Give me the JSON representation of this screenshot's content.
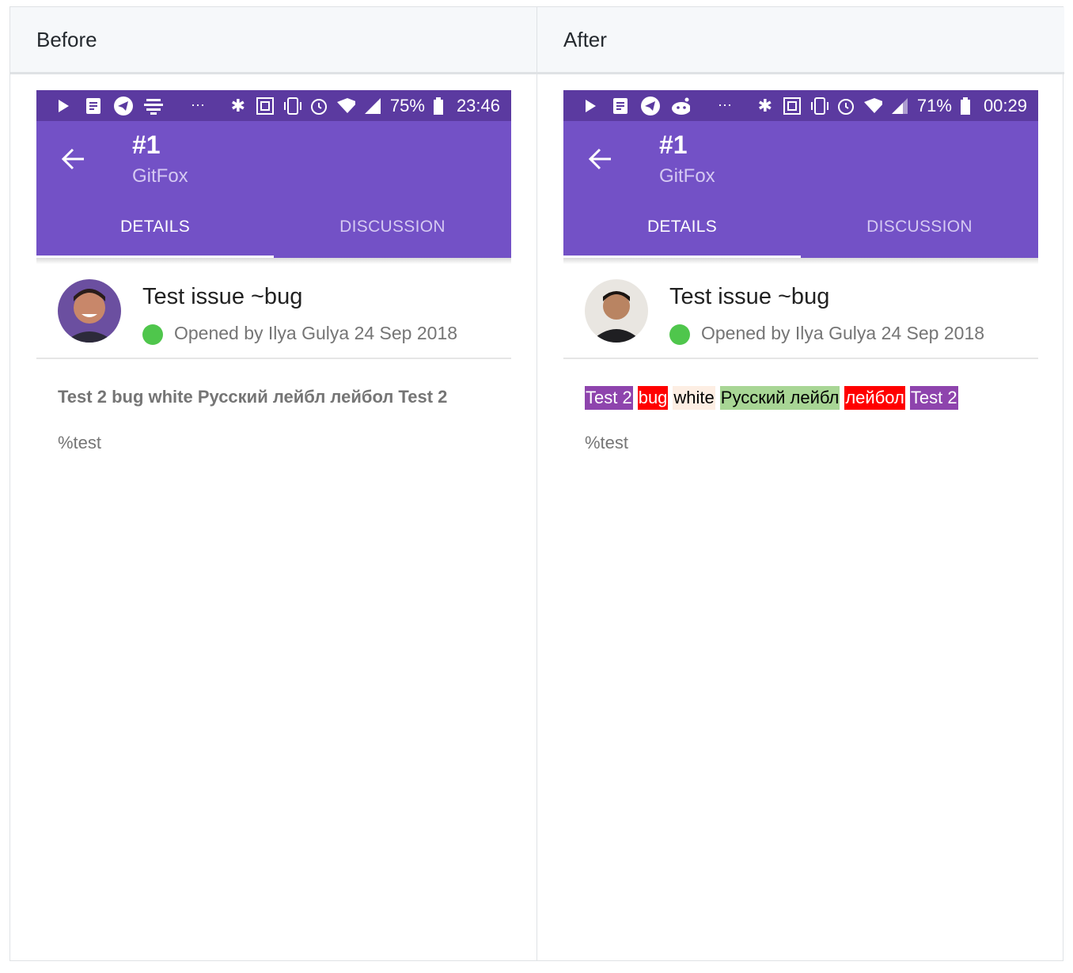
{
  "columns": {
    "before": {
      "header": "Before"
    },
    "after": {
      "header": "After"
    }
  },
  "before": {
    "status": {
      "battery": "75%",
      "time": "23:46"
    },
    "toolbar": {
      "title": "#1",
      "subtitle": "GitFox"
    },
    "tabs": [
      "DETAILS",
      "DISCUSSION"
    ],
    "issue": {
      "title": "Test issue ~bug",
      "meta": "Opened by Ilya Gulya 24 Sep 2018"
    },
    "body": {
      "labels_line": "Test 2 bug white Русский лейбл лейбол Test 2",
      "milestone": "%test"
    }
  },
  "after": {
    "status": {
      "battery": "71%",
      "time": "00:29"
    },
    "toolbar": {
      "title": "#1",
      "subtitle": "GitFox"
    },
    "tabs": [
      "DETAILS",
      "DISCUSSION"
    ],
    "issue": {
      "title": "Test issue ~bug",
      "meta": "Opened by Ilya Gulya 24 Sep 2018"
    },
    "body": {
      "labels": [
        {
          "text": "Test 2",
          "bg": "#8e44ad",
          "fg": "#ffffff"
        },
        {
          "text": "bug",
          "bg": "#ff0000",
          "fg": "#ffffff"
        },
        {
          "text": "white",
          "bg": "#fdeee3",
          "fg": "#000000"
        },
        {
          "text": "Русский лейбл",
          "bg": "#a8d695",
          "fg": "#000000"
        },
        {
          "text": "лейбол",
          "bg": "#ff0000",
          "fg": "#ffffff"
        },
        {
          "text": "Test 2",
          "bg": "#8e44ad",
          "fg": "#ffffff"
        }
      ],
      "milestone": "%test"
    }
  },
  "colors": {
    "statusbar": "#5b3aa0",
    "toolbar": "#7351c6",
    "opened": "#4fc64c"
  }
}
